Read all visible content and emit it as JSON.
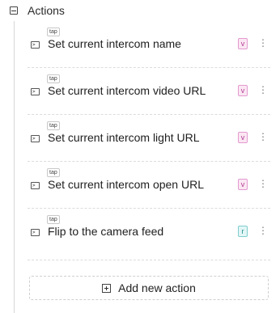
{
  "section": {
    "title": "Actions"
  },
  "actions": [
    {
      "trigger": "tap",
      "label": "Set current intercom name",
      "badge": "v"
    },
    {
      "trigger": "tap",
      "label": "Set current intercom video URL",
      "badge": "v"
    },
    {
      "trigger": "tap",
      "label": "Set current intercom light URL",
      "badge": "v"
    },
    {
      "trigger": "tap",
      "label": "Set current intercom open URL",
      "badge": "v"
    },
    {
      "trigger": "tap",
      "label": "Flip to the camera feed",
      "badge": "r"
    }
  ],
  "add_button": {
    "label": "Add new action"
  },
  "icons": {
    "collapse": "collapse-minus-icon",
    "command": "terminal-icon",
    "more": "kebab-menu-icon",
    "add": "plus-square-icon"
  }
}
